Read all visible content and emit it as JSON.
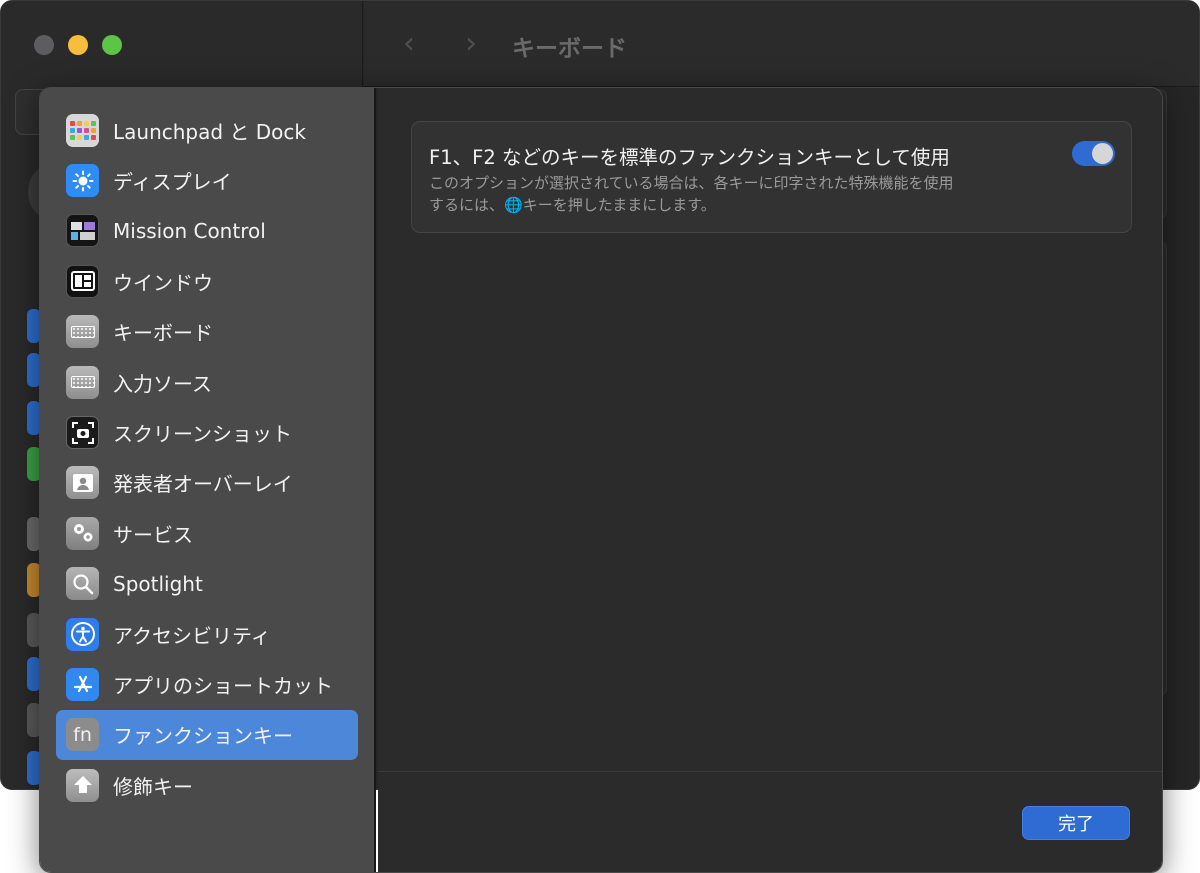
{
  "window": {
    "toolbar_title": "キーボード",
    "back_glyph": "‹",
    "forward_glyph": "›"
  },
  "sidebar": {
    "items": [
      {
        "label": "Launchpad と Dock",
        "icon": "launchpad-icon"
      },
      {
        "label": "ディスプレイ",
        "icon": "display-icon"
      },
      {
        "label": "Mission Control",
        "icon": "mission-control-icon"
      },
      {
        "label": "ウインドウ",
        "icon": "window-icon"
      },
      {
        "label": "キーボード",
        "icon": "keyboard-icon"
      },
      {
        "label": "入力ソース",
        "icon": "input-source-icon"
      },
      {
        "label": "スクリーンショット",
        "icon": "screenshot-icon"
      },
      {
        "label": "発表者オーバーレイ",
        "icon": "presenter-overlay-icon"
      },
      {
        "label": "サービス",
        "icon": "services-icon"
      },
      {
        "label": "Spotlight",
        "icon": "spotlight-icon"
      },
      {
        "label": "アクセシビリティ",
        "icon": "accessibility-icon"
      },
      {
        "label": "アプリのショートカット",
        "icon": "app-shortcuts-icon"
      },
      {
        "label": "ファンクションキー",
        "icon": "fn-icon",
        "icon_text": "fn"
      },
      {
        "label": "修飾キー",
        "icon": "modifier-keys-icon"
      }
    ],
    "selected_index": 12
  },
  "option": {
    "title": "F1、F2 などのキーを標準のファンクションキーとして使用",
    "desc_line1": "このオプションが選択されている場合は、各キーに印字された特殊機能を使用",
    "desc_line2_pre": "するには、",
    "desc_line2_post": "キーを押したままにします。",
    "globe_glyph": "🌐",
    "toggle_on": true
  },
  "footer": {
    "done_label": "完了"
  },
  "colors": {
    "accent": "#2e6bd3",
    "selection": "#4d87d9"
  }
}
